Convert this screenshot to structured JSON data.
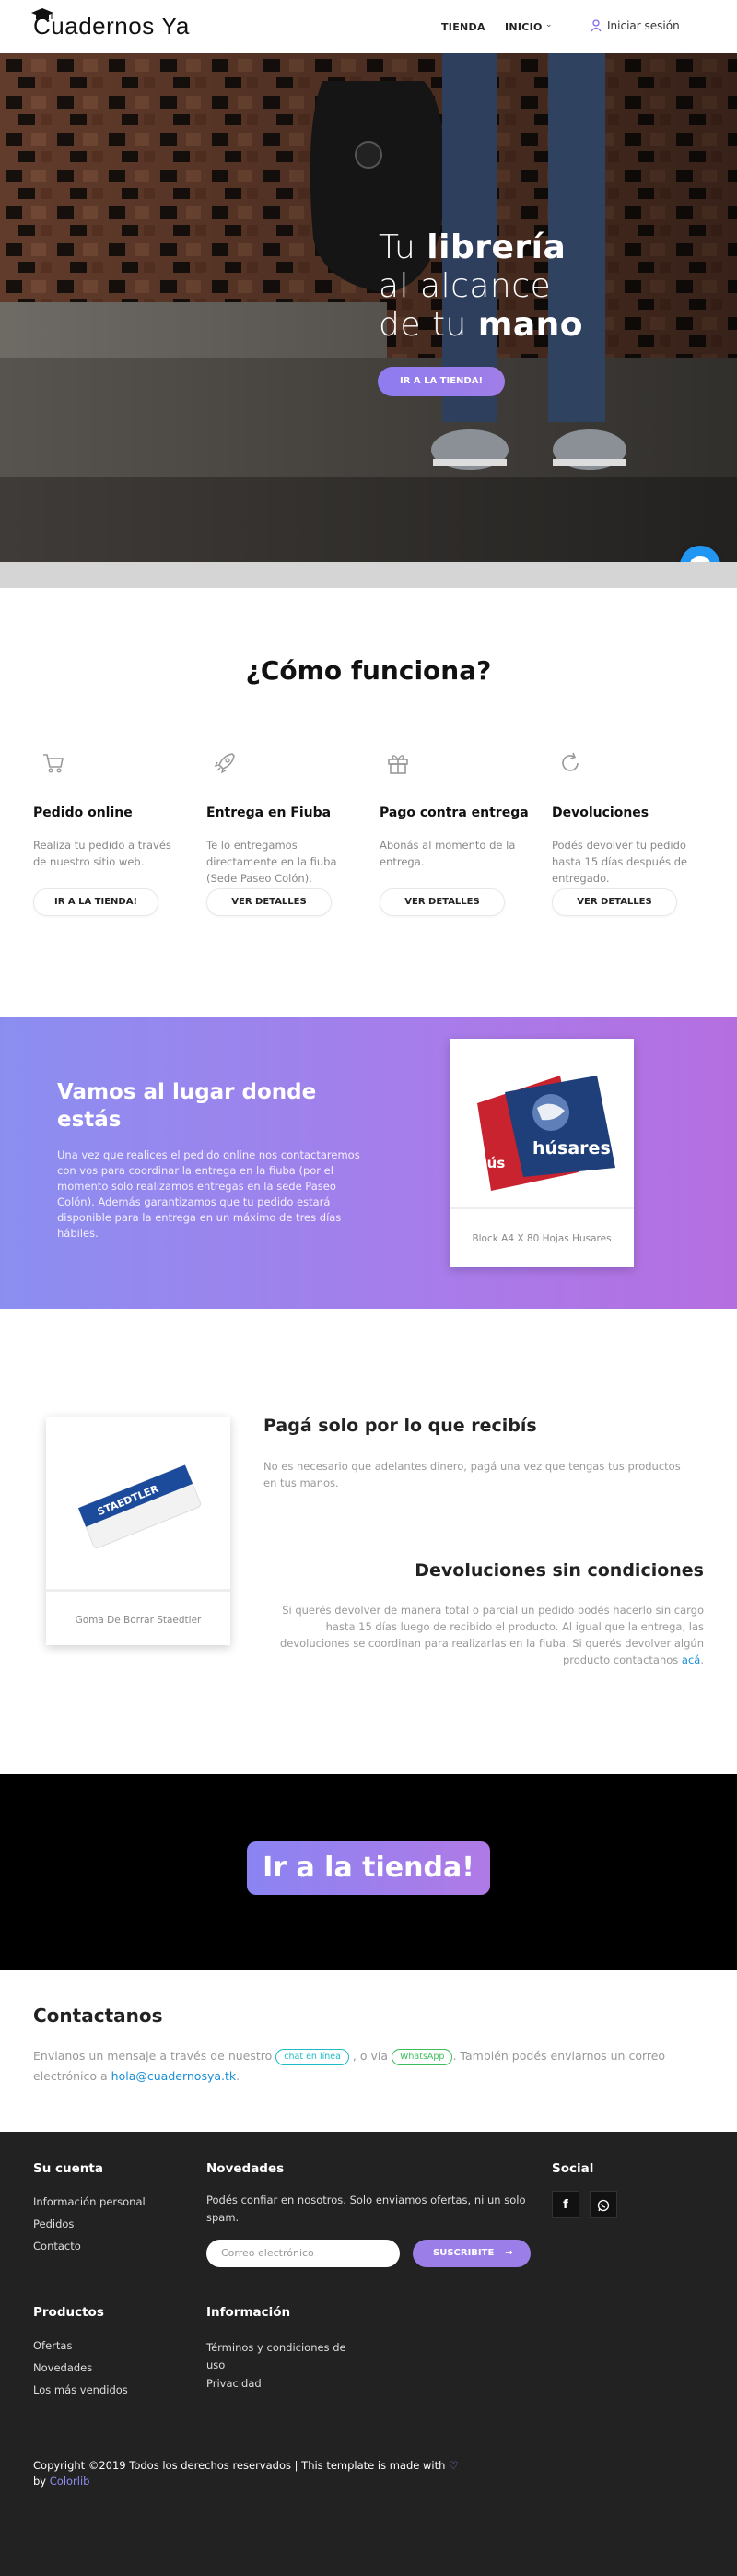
{
  "header": {
    "logo": "Cuadernos Ya",
    "nav": [
      {
        "label": "TIENDA"
      },
      {
        "label": "INICIO"
      }
    ],
    "login_label": "Iniciar sesión"
  },
  "hero": {
    "line1_light": "Tu ",
    "line1_bold": "librería",
    "line2_light": "al alcance",
    "line3_light": "de tu ",
    "line3_bold": "mano",
    "button_label": "IR A LA TIENDA!"
  },
  "how": {
    "title": "¿Cómo funciona?",
    "steps": [
      {
        "icon": "cart-icon",
        "title": "Pedido online",
        "desc": "Realiza tu pedido a través de nuestro sitio web.",
        "button": "IR A LA TIENDA!"
      },
      {
        "icon": "rocket-icon",
        "title": "Entrega en Fiuba",
        "desc": "Te lo entregamos directamente en la fiuba (Sede Paseo Colón).",
        "button": "VER DETALLES"
      },
      {
        "icon": "gift-icon",
        "title": "Pago contra entrega",
        "desc": "Abonás al momento de la entrega.",
        "button": "VER DETALLES"
      },
      {
        "icon": "refresh-icon",
        "title": "Devoluciones",
        "desc": "Podés devolver tu pedido hasta 15 días después de entregado.",
        "button": "VER DETALLES"
      }
    ]
  },
  "delivery": {
    "title": "Vamos al lugar donde estás",
    "text": "Una vez que realices el pedido online nos contactaremos con vos para coordinar la entrega en la fiuba (por el momento solo realizamos entregas en la sede Paseo Colón). Además garantizamos que tu pedido estará disponible para la entrega en un máximo de tres días hábiles.",
    "product_caption": "Block A4 X 80 Hojas Husares",
    "product_brand": "húsares"
  },
  "pay": {
    "title": "Pagá solo por lo que recibís",
    "text": "No es necesario que adelantes dinero, pagá una vez que tengas tus productos en tus manos.",
    "product_caption": "Goma De Borrar Staedtler",
    "product_brand": "STAEDTLER"
  },
  "returns": {
    "title": "Devoluciones sin condiciones",
    "text": "Si querés devolver de manera total o parcial un pedido podés hacerlo sin cargo hasta 15 días luego de recibido el producto. Al igual que la entrega, las devoluciones se coordinan para realizarlas en la fiuba. Si querés devolver algún producto contactanos ",
    "link": "acá",
    "end": "."
  },
  "cta": {
    "label": "Ir a la tienda!"
  },
  "contact": {
    "title": "Contactanos",
    "text1": "Envianos un mensaje a través de nuestro ",
    "pill_chat": "chat en línea",
    "text2": " , o vía ",
    "pill_wa": "WhatsApp",
    "text3": ". También podés enviarnos un correo electrónico a ",
    "email": "hola@cuadernosya.tk",
    "text4": "."
  },
  "footer": {
    "account": {
      "title": "Su cuenta",
      "links": [
        "Información personal",
        "Pedidos",
        "Contacto"
      ]
    },
    "news": {
      "title": "Novedades",
      "text": "Podés confiar en nosotros. Solo enviamos ofertas, ni un solo spam.",
      "email_placeholder": "Correo electrónico",
      "subscribe": "SUSCRIBITE"
    },
    "social": {
      "title": "Social"
    },
    "products": {
      "title": "Productos",
      "links": [
        "Ofertas",
        "Novedades",
        "Los más vendidos"
      ]
    },
    "info": {
      "title": "Información",
      "links": [
        "Términos y condiciones de uso",
        "Privacidad"
      ]
    },
    "copyright": "Copyright ©2019 Todos los derechos reservados | This template is made with ",
    "by": "by ",
    "brand": "Colorlib"
  },
  "colors": {
    "accent": "#9c7ee8",
    "link": "#1a8fd8",
    "footer_bg": "#222222"
  }
}
